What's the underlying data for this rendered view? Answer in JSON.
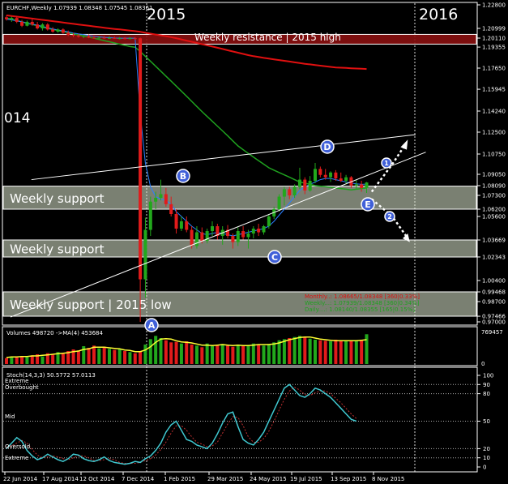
{
  "header": {
    "symbol": "EURCHF,Weekly",
    "ohlc": "1.07939 1.08348 1.07545 1.08361"
  },
  "year_labels": {
    "left": "2015",
    "right": "2016",
    "edge": "014"
  },
  "colors": {
    "background": "#000000",
    "bull": "#22a81c",
    "bear": "#e21b1b",
    "ma_green": "#1fa11f",
    "ma_red": "#e01010",
    "ma_blue": "#2a7fff",
    "zone": "#dfe9cf",
    "resistance": "#8a1010",
    "volume_ma": "#ffff33",
    "stoch": "#40c8d0",
    "stoch_signal": "#c03030"
  },
  "zones": [
    {
      "label": "Weekly resistance | 2015 high",
      "y_top": 1.2045,
      "y_bot": 1.2005,
      "kind": "resistance"
    },
    {
      "label": "Weekly support",
      "y_top": 1.0805,
      "y_bot": 1.062,
      "kind": "support"
    },
    {
      "label": "Weekly support",
      "y_top": 1.0367,
      "y_bot": 1.0234,
      "kind": "support"
    },
    {
      "label": "Weekly support | 2015 low",
      "y_top": 0.9947,
      "y_bot": 0.9747,
      "kind": "support"
    }
  ],
  "waypoints": [
    {
      "label": "A",
      "x": 1.2,
      "y": 0.966
    },
    {
      "label": "B",
      "x": 4.85,
      "y": 1.086
    },
    {
      "label": "C",
      "x": 13.6,
      "y": 1.025
    },
    {
      "label": "D",
      "x": 16.4,
      "y": 1.107
    },
    {
      "label": "E",
      "x": 18.2,
      "y": 1.066
    },
    {
      "label": "1",
      "x": 19.1,
      "y": 1.092
    },
    {
      "label": "2",
      "x": 19.3,
      "y": 1.056
    }
  ],
  "ma_legend": [
    {
      "text": "Monthly..: 1.08665/1.08348 [360|0.33%]",
      "color": "#e01010"
    },
    {
      "text": "Weekly...: 1.07939/1.08348 [360|0.34%]",
      "color": "#1fa11f"
    },
    {
      "text": "Daily....: 1.08140/1.08355 [165|0.15%]",
      "color": "#1fa11f"
    }
  ],
  "volume_panel": {
    "title": "Volumes 498720  ->MA(4) 453684",
    "scale_top": "769457",
    "scale_bottom": "0"
  },
  "stoch_panel": {
    "title": "Stoch(14,3,3) 50.5772 57.0113",
    "labels": {
      "overbought": "Overbought",
      "mid": "Mid",
      "oversold": "Oversold",
      "extreme_top": "Extreme",
      "extreme_bottom": "Extreme"
    },
    "scale": [
      "100",
      "90",
      "80",
      "50",
      "20",
      "10",
      "0"
    ]
  },
  "chart_data": {
    "type": "candlestick",
    "title": "EURCHF,Weekly",
    "y_ticks": [
      "1.22800",
      "1.20999",
      "1.20110",
      "1.19355",
      "1.17650",
      "1.15945",
      "1.14240",
      "1.12500",
      "1.10750",
      "1.09050",
      "1.08090",
      "1.07300",
      "1.06200",
      "1.05600",
      "1.03669",
      "1.02343",
      "1.00400",
      "0.99468",
      "0.98700",
      "0.97466",
      "0.97000"
    ],
    "ylim": [
      0.97,
      1.228
    ],
    "x_ticks": [
      "22 Jun 2014",
      "17 Aug 2014",
      "12 Oct 2014",
      "7 Dec 2014",
      "1 Feb 2015",
      "29 Mar 2015",
      "24 May 2015",
      "19 Jul 2015",
      "13 Sep 2015",
      "8 Nov 2015"
    ],
    "candles": [
      {
        "o": 1.2185,
        "h": 1.22,
        "l": 1.216,
        "c": 1.217
      },
      {
        "o": 1.217,
        "h": 1.219,
        "l": 1.215,
        "c": 1.218
      },
      {
        "o": 1.218,
        "h": 1.2195,
        "l": 1.214,
        "c": 1.215
      },
      {
        "o": 1.215,
        "h": 1.2165,
        "l": 1.211,
        "c": 1.212
      },
      {
        "o": 1.212,
        "h": 1.216,
        "l": 1.2115,
        "c": 1.215
      },
      {
        "o": 1.215,
        "h": 1.217,
        "l": 1.212,
        "c": 1.213
      },
      {
        "o": 1.213,
        "h": 1.215,
        "l": 1.209,
        "c": 1.21
      },
      {
        "o": 1.21,
        "h": 1.214,
        "l": 1.208,
        "c": 1.213
      },
      {
        "o": 1.213,
        "h": 1.214,
        "l": 1.208,
        "c": 1.209
      },
      {
        "o": 1.209,
        "h": 1.211,
        "l": 1.206,
        "c": 1.207
      },
      {
        "o": 1.207,
        "h": 1.21,
        "l": 1.206,
        "c": 1.209
      },
      {
        "o": 1.209,
        "h": 1.21,
        "l": 1.205,
        "c": 1.206
      },
      {
        "o": 1.206,
        "h": 1.208,
        "l": 1.203,
        "c": 1.204
      },
      {
        "o": 1.204,
        "h": 1.206,
        "l": 1.202,
        "c": 1.2035
      },
      {
        "o": 1.2035,
        "h": 1.205,
        "l": 1.2015,
        "c": 1.2025
      },
      {
        "o": 1.2025,
        "h": 1.204,
        "l": 1.201,
        "c": 1.203
      },
      {
        "o": 1.203,
        "h": 1.2045,
        "l": 1.201,
        "c": 1.2015
      },
      {
        "o": 1.2015,
        "h": 1.2035,
        "l": 1.2005,
        "c": 1.201
      },
      {
        "o": 1.201,
        "h": 1.203,
        "l": 1.2005,
        "c": 1.2015
      },
      {
        "o": 1.2015,
        "h": 1.203,
        "l": 1.2005,
        "c": 1.201
      },
      {
        "o": 1.201,
        "h": 1.203,
        "l": 1.2005,
        "c": 1.2012
      },
      {
        "o": 1.2012,
        "h": 1.2025,
        "l": 1.2005,
        "c": 1.201
      },
      {
        "o": 1.201,
        "h": 1.202,
        "l": 1.2,
        "c": 1.201
      },
      {
        "o": 1.201,
        "h": 1.202,
        "l": 1.2,
        "c": 1.2008
      },
      {
        "o": 1.2008,
        "h": 1.202,
        "l": 1.2,
        "c": 1.201
      },
      {
        "o": 1.201,
        "h": 1.202,
        "l": 1.2,
        "c": 1.2009
      },
      {
        "o": 1.2009,
        "h": 1.2015,
        "l": 0.97,
        "c": 1.005
      },
      {
        "o": 1.005,
        "h": 1.055,
        "l": 0.99,
        "c": 1.045
      },
      {
        "o": 1.045,
        "h": 1.072,
        "l": 1.04,
        "c": 1.068
      },
      {
        "o": 1.068,
        "h": 1.076,
        "l": 1.062,
        "c": 1.071
      },
      {
        "o": 1.071,
        "h": 1.086,
        "l": 1.069,
        "c": 1.074
      },
      {
        "o": 1.074,
        "h": 1.079,
        "l": 1.064,
        "c": 1.066
      },
      {
        "o": 1.066,
        "h": 1.072,
        "l": 1.056,
        "c": 1.058
      },
      {
        "o": 1.058,
        "h": 1.062,
        "l": 1.042,
        "c": 1.046
      },
      {
        "o": 1.046,
        "h": 1.056,
        "l": 1.044,
        "c": 1.052
      },
      {
        "o": 1.052,
        "h": 1.056,
        "l": 1.043,
        "c": 1.045
      },
      {
        "o": 1.045,
        "h": 1.048,
        "l": 1.03,
        "c": 1.032
      },
      {
        "o": 1.032,
        "h": 1.048,
        "l": 1.03,
        "c": 1.043
      },
      {
        "o": 1.043,
        "h": 1.047,
        "l": 1.034,
        "c": 1.036
      },
      {
        "o": 1.036,
        "h": 1.046,
        "l": 1.034,
        "c": 1.044
      },
      {
        "o": 1.044,
        "h": 1.052,
        "l": 1.04,
        "c": 1.048
      },
      {
        "o": 1.048,
        "h": 1.05,
        "l": 1.037,
        "c": 1.04
      },
      {
        "o": 1.04,
        "h": 1.048,
        "l": 1.033,
        "c": 1.045
      },
      {
        "o": 1.045,
        "h": 1.049,
        "l": 1.038,
        "c": 1.04
      },
      {
        "o": 1.04,
        "h": 1.042,
        "l": 1.03,
        "c": 1.035
      },
      {
        "o": 1.035,
        "h": 1.047,
        "l": 1.032,
        "c": 1.044
      },
      {
        "o": 1.044,
        "h": 1.048,
        "l": 1.037,
        "c": 1.039
      },
      {
        "o": 1.039,
        "h": 1.045,
        "l": 1.03,
        "c": 1.042
      },
      {
        "o": 1.042,
        "h": 1.048,
        "l": 1.038,
        "c": 1.046
      },
      {
        "o": 1.046,
        "h": 1.05,
        "l": 1.04,
        "c": 1.043
      },
      {
        "o": 1.043,
        "h": 1.049,
        "l": 1.041,
        "c": 1.048
      },
      {
        "o": 1.048,
        "h": 1.058,
        "l": 1.046,
        "c": 1.056
      },
      {
        "o": 1.056,
        "h": 1.064,
        "l": 1.054,
        "c": 1.062
      },
      {
        "o": 1.062,
        "h": 1.074,
        "l": 1.06,
        "c": 1.072
      },
      {
        "o": 1.072,
        "h": 1.08,
        "l": 1.065,
        "c": 1.078
      },
      {
        "o": 1.078,
        "h": 1.08,
        "l": 1.07,
        "c": 1.073
      },
      {
        "o": 1.073,
        "h": 1.082,
        "l": 1.071,
        "c": 1.08
      },
      {
        "o": 1.08,
        "h": 1.096,
        "l": 1.078,
        "c": 1.086
      },
      {
        "o": 1.086,
        "h": 1.088,
        "l": 1.074,
        "c": 1.077
      },
      {
        "o": 1.077,
        "h": 1.089,
        "l": 1.076,
        "c": 1.085
      },
      {
        "o": 1.085,
        "h": 1.1,
        "l": 1.083,
        "c": 1.095
      },
      {
        "o": 1.095,
        "h": 1.097,
        "l": 1.088,
        "c": 1.09
      },
      {
        "o": 1.09,
        "h": 1.095,
        "l": 1.086,
        "c": 1.088
      },
      {
        "o": 1.088,
        "h": 1.093,
        "l": 1.084,
        "c": 1.092
      },
      {
        "o": 1.092,
        "h": 1.094,
        "l": 1.085,
        "c": 1.087
      },
      {
        "o": 1.087,
        "h": 1.092,
        "l": 1.084,
        "c": 1.085
      },
      {
        "o": 1.085,
        "h": 1.09,
        "l": 1.082,
        "c": 1.088
      },
      {
        "o": 1.088,
        "h": 1.089,
        "l": 1.079,
        "c": 1.081
      },
      {
        "o": 1.081,
        "h": 1.086,
        "l": 1.078,
        "c": 1.082
      },
      {
        "o": 1.082,
        "h": 1.085,
        "l": 1.076,
        "c": 1.079
      },
      {
        "o": 1.079,
        "h": 1.084,
        "l": 1.075,
        "c": 1.0836
      }
    ],
    "volumes": [
      0.11,
      0.14,
      0.12,
      0.15,
      0.13,
      0.16,
      0.18,
      0.14,
      0.2,
      0.17,
      0.22,
      0.19,
      0.24,
      0.27,
      0.25,
      0.33,
      0.3,
      0.34,
      0.29,
      0.32,
      0.28,
      0.26,
      0.27,
      0.24,
      0.22,
      0.2,
      0.24,
      0.36,
      0.46,
      0.52,
      0.48,
      0.44,
      0.4,
      0.41,
      0.38,
      0.42,
      0.36,
      0.34,
      0.31,
      0.38,
      0.33,
      0.35,
      0.37,
      0.34,
      0.32,
      0.36,
      0.33,
      0.35,
      0.38,
      0.36,
      0.34,
      0.37,
      0.4,
      0.44,
      0.46,
      0.48,
      0.5,
      0.52,
      0.49,
      0.47,
      0.45,
      0.44,
      0.43,
      0.42,
      0.45,
      0.44,
      0.43,
      0.42,
      0.44,
      0.45,
      0.55
    ],
    "volume_ma": [
      0.12,
      0.13,
      0.13,
      0.14,
      0.14,
      0.15,
      0.15,
      0.16,
      0.17,
      0.18,
      0.19,
      0.2,
      0.21,
      0.23,
      0.24,
      0.27,
      0.28,
      0.31,
      0.31,
      0.31,
      0.3,
      0.29,
      0.28,
      0.26,
      0.25,
      0.23,
      0.23,
      0.26,
      0.32,
      0.4,
      0.46,
      0.47,
      0.46,
      0.43,
      0.41,
      0.4,
      0.39,
      0.37,
      0.35,
      0.35,
      0.34,
      0.35,
      0.36,
      0.35,
      0.34,
      0.35,
      0.34,
      0.34,
      0.35,
      0.36,
      0.36,
      0.36,
      0.37,
      0.39,
      0.42,
      0.45,
      0.47,
      0.49,
      0.5,
      0.5,
      0.48,
      0.46,
      0.45,
      0.44,
      0.43,
      0.43,
      0.43,
      0.43,
      0.43,
      0.44,
      0.45
    ],
    "stoch_k": [
      20,
      26,
      32,
      28,
      18,
      12,
      8,
      10,
      14,
      11,
      8,
      6,
      9,
      14,
      13,
      9,
      7,
      6,
      8,
      11,
      7,
      5,
      4,
      3,
      4,
      6,
      5,
      9,
      12,
      18,
      26,
      38,
      46,
      50,
      40,
      30,
      28,
      24,
      22,
      20,
      26,
      36,
      48,
      58,
      60,
      44,
      30,
      26,
      24,
      30,
      38,
      50,
      62,
      74,
      86,
      90,
      84,
      78,
      76,
      80,
      86,
      84,
      80,
      76,
      70,
      64,
      58,
      52,
      50
    ],
    "stoch_d": [
      22,
      23,
      26,
      29,
      26,
      19,
      13,
      10,
      11,
      12,
      11,
      9,
      8,
      10,
      12,
      12,
      10,
      7,
      7,
      8,
      9,
      8,
      5,
      4,
      4,
      4,
      5,
      7,
      9,
      13,
      19,
      27,
      37,
      45,
      45,
      40,
      33,
      27,
      25,
      22,
      23,
      27,
      37,
      47,
      55,
      54,
      45,
      33,
      27,
      27,
      31,
      39,
      50,
      62,
      74,
      83,
      87,
      84,
      79,
      78,
      81,
      83,
      83,
      80,
      75,
      70,
      64,
      58,
      53
    ],
    "ma_weekly_green": [
      1.218,
      1.217,
      1.216,
      1.215,
      1.214,
      1.213,
      1.212,
      1.211,
      1.21,
      1.209,
      1.208,
      1.207,
      1.206,
      1.205,
      1.204,
      1.203,
      1.202,
      1.201,
      1.2,
      1.199,
      1.198,
      1.197,
      1.196,
      1.195,
      1.194,
      1.1935,
      1.19,
      1.186,
      1.182,
      1.178,
      1.174,
      1.17,
      1.166,
      1.162,
      1.158,
      1.154,
      1.15,
      1.146,
      1.142,
      1.138,
      1.134,
      1.13,
      1.126,
      1.122,
      1.118,
      1.114,
      1.111,
      1.108,
      1.105,
      1.102,
      1.099,
      1.096,
      1.094,
      1.092,
      1.09,
      1.088,
      1.086,
      1.084,
      1.083,
      1.082,
      1.081,
      1.0805,
      1.08,
      1.0795,
      1.079,
      1.0785,
      1.078,
      1.0775,
      1.078,
      1.0785,
      1.079
    ],
    "ma_red": [
      1.22,
      1.2195,
      1.219,
      1.2185,
      1.218,
      1.2175,
      1.217,
      1.2165,
      1.216,
      1.2155,
      1.215,
      1.2145,
      1.214,
      1.2135,
      1.213,
      1.2125,
      1.212,
      1.2115,
      1.211,
      1.2105,
      1.21,
      1.2095,
      1.209,
      1.2085,
      1.208,
      1.2075,
      1.2068,
      1.206,
      1.2052,
      1.2044,
      1.2036,
      1.2028,
      1.202,
      1.201,
      1.2,
      1.199,
      1.198,
      1.197,
      1.196,
      1.195,
      1.194,
      1.193,
      1.192,
      1.191,
      1.19,
      1.189,
      1.188,
      1.187,
      1.1862,
      1.1855,
      1.1848,
      1.1842,
      1.1836,
      1.183,
      1.1824,
      1.1818,
      1.1812,
      1.1806,
      1.18,
      1.1795,
      1.179,
      1.1785,
      1.178,
      1.1775,
      1.177,
      1.1768,
      1.1766,
      1.1764,
      1.1762,
      1.176,
      1.1758
    ],
    "ma_blue": [
      1.217,
      1.2165,
      1.2158,
      1.215,
      1.214,
      1.2132,
      1.2125,
      1.2115,
      1.2105,
      1.2095,
      1.2085,
      1.2078,
      1.2068,
      1.2058,
      1.205,
      1.2042,
      1.2035,
      1.2028,
      1.2022,
      1.2018,
      1.2015,
      1.2012,
      1.201,
      1.201,
      1.201,
      1.201,
      1.14,
      1.1,
      1.08,
      1.072,
      1.07,
      1.069,
      1.066,
      1.06,
      1.056,
      1.052,
      1.048,
      1.045,
      1.042,
      1.041,
      1.042,
      1.043,
      1.042,
      1.041,
      1.04,
      1.041,
      1.042,
      1.043,
      1.044,
      1.045,
      1.046,
      1.048,
      1.052,
      1.057,
      1.062,
      1.067,
      1.072,
      1.077,
      1.08,
      1.082,
      1.084,
      1.086,
      1.087,
      1.087,
      1.086,
      1.085,
      1.084,
      1.083,
      1.0825,
      1.082,
      1.0822
    ]
  }
}
